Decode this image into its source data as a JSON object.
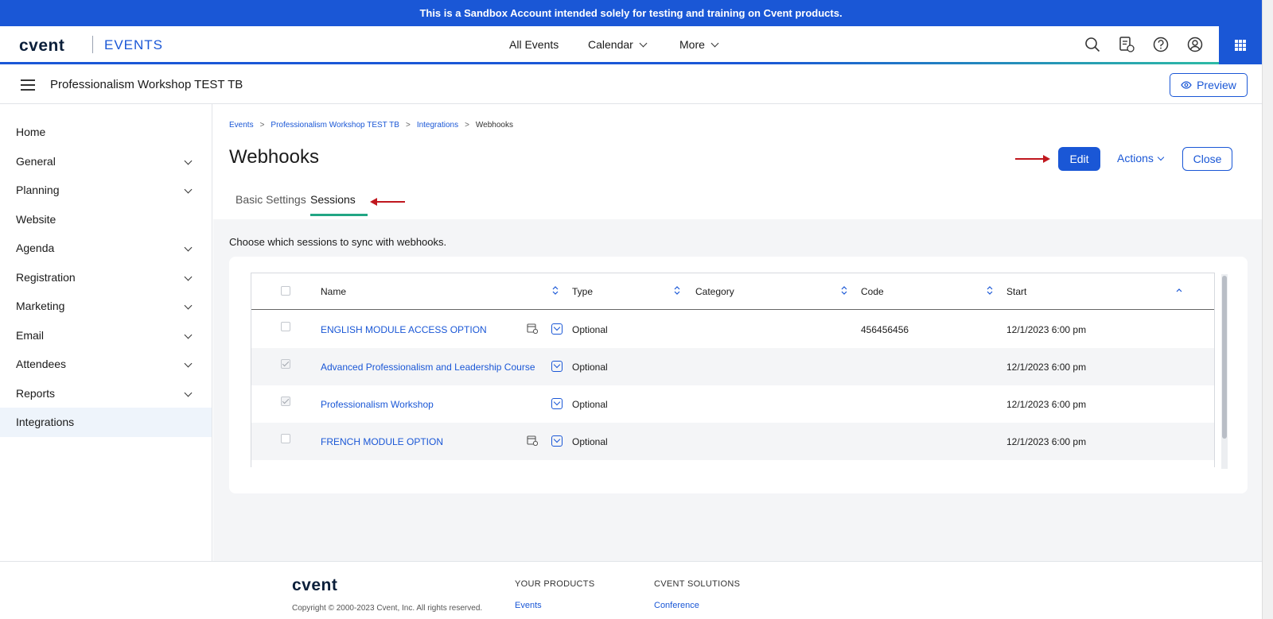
{
  "banner": {
    "text": "This is a Sandbox Account intended solely for testing and training on Cvent products."
  },
  "topnav": {
    "logo": "cvent",
    "product": "EVENTS",
    "items": [
      {
        "label": "All Events"
      },
      {
        "label": "Calendar"
      },
      {
        "label": "More"
      }
    ],
    "icons": [
      "search-icon",
      "tasks-icon",
      "help-icon",
      "user-icon",
      "app-grid-icon"
    ]
  },
  "subheader": {
    "event_title": "Professionalism Workshop TEST TB",
    "preview_label": "Preview"
  },
  "sidebar": {
    "items": [
      {
        "label": "Home",
        "expandable": false
      },
      {
        "label": "General",
        "expandable": true
      },
      {
        "label": "Planning",
        "expandable": true
      },
      {
        "label": "Website",
        "expandable": false
      },
      {
        "label": "Agenda",
        "expandable": true
      },
      {
        "label": "Registration",
        "expandable": true
      },
      {
        "label": "Marketing",
        "expandable": true
      },
      {
        "label": "Email",
        "expandable": true
      },
      {
        "label": "Attendees",
        "expandable": true
      },
      {
        "label": "Reports",
        "expandable": true
      },
      {
        "label": "Integrations",
        "expandable": false,
        "active": true
      }
    ]
  },
  "breadcrumb": [
    "Events",
    "Professionalism Workshop TEST TB",
    "Integrations",
    "Webhooks"
  ],
  "page": {
    "title": "Webhooks",
    "edit_label": "Edit",
    "actions_label": "Actions",
    "close_label": "Close",
    "tabs": [
      {
        "label": "Basic Settings",
        "active": false
      },
      {
        "label": "Sessions",
        "active": true
      }
    ],
    "description": "Choose which sessions to sync with webhooks."
  },
  "table": {
    "columns": [
      "Name",
      "Type",
      "Category",
      "Code",
      "Start"
    ],
    "rows": [
      {
        "name": "ENGLISH MODULE ACCESS OPTION",
        "type": "Optional",
        "category": "",
        "code": "456456456",
        "start": "12/1/2023 6:00 pm",
        "checked": false,
        "has_calendar_icon": true
      },
      {
        "name": "Advanced Professionalism and Leadership Course",
        "type": "Optional",
        "category": "",
        "code": "",
        "start": "12/1/2023 6:00 pm",
        "checked": true,
        "has_calendar_icon": false
      },
      {
        "name": "Professionalism Workshop",
        "type": "Optional",
        "category": "",
        "code": "",
        "start": "12/1/2023 6:00 pm",
        "checked": true,
        "has_calendar_icon": false
      },
      {
        "name": "FRENCH MODULE OPTION",
        "type": "Optional",
        "category": "",
        "code": "",
        "start": "12/1/2023 6:00 pm",
        "checked": false,
        "has_calendar_icon": true
      }
    ]
  },
  "footer": {
    "logo": "cvent",
    "copyright": "Copyright © 2000-2023 Cvent, Inc. All rights reserved.",
    "products_heading": "YOUR PRODUCTS",
    "products_link": "Events",
    "solutions_heading": "CVENT SOLUTIONS",
    "solutions_link": "Conference"
  },
  "colors": {
    "brand": "#1a57d6",
    "accent_green": "#22a684",
    "annotation_arrow": "#c0171e"
  }
}
